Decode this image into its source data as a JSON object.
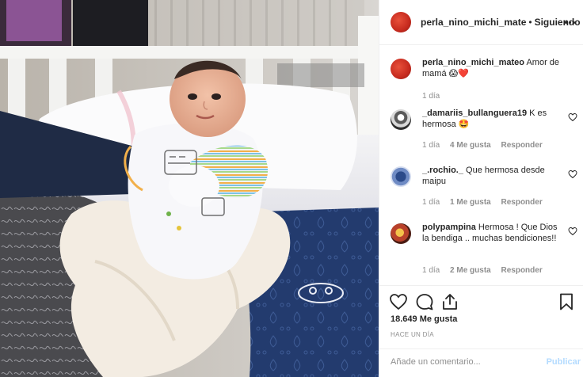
{
  "photo": {
    "alt_subject": "newborn-baby-in-crib"
  },
  "header": {
    "username": "perla_nino_michi_mate",
    "separator": "•",
    "follow_status": "Siguiendo",
    "more_icon": "more-horizontal-icon"
  },
  "caption": {
    "username": "perla_nino_michi_mateo",
    "text": "Amor de mamá 😱❤️",
    "time": "1 día"
  },
  "comments": [
    {
      "username": "_damariis_bullanguera19",
      "text": "K es hermosa 🤩",
      "time": "1 día",
      "likes": "4 Me gusta",
      "reply": "Responder"
    },
    {
      "username": "_.rochio._",
      "text": "Que hermosa desde maipu",
      "time": "1 día",
      "likes": "1 Me gusta",
      "reply": "Responder"
    },
    {
      "username": "polypampina",
      "text": "Hermosa ! Que Dios la bendiga .. muchas bendiciones!!",
      "time": "1 día",
      "likes": "2 Me gusta",
      "reply": "Responder"
    }
  ],
  "actions": {
    "like_icon": "heart-icon",
    "comment_icon": "comment-icon",
    "share_icon": "share-icon",
    "save_icon": "bookmark-icon"
  },
  "likes_count": "18.649 Me gusta",
  "posted": "HACE UN DÍA",
  "comment_box": {
    "placeholder": "Añade un comentario...",
    "publish_label": "Publicar"
  },
  "colors": {
    "text": "#262626",
    "muted": "#8e8e8e",
    "publish_disabled": "#b3dbff",
    "border": "#efefef"
  }
}
